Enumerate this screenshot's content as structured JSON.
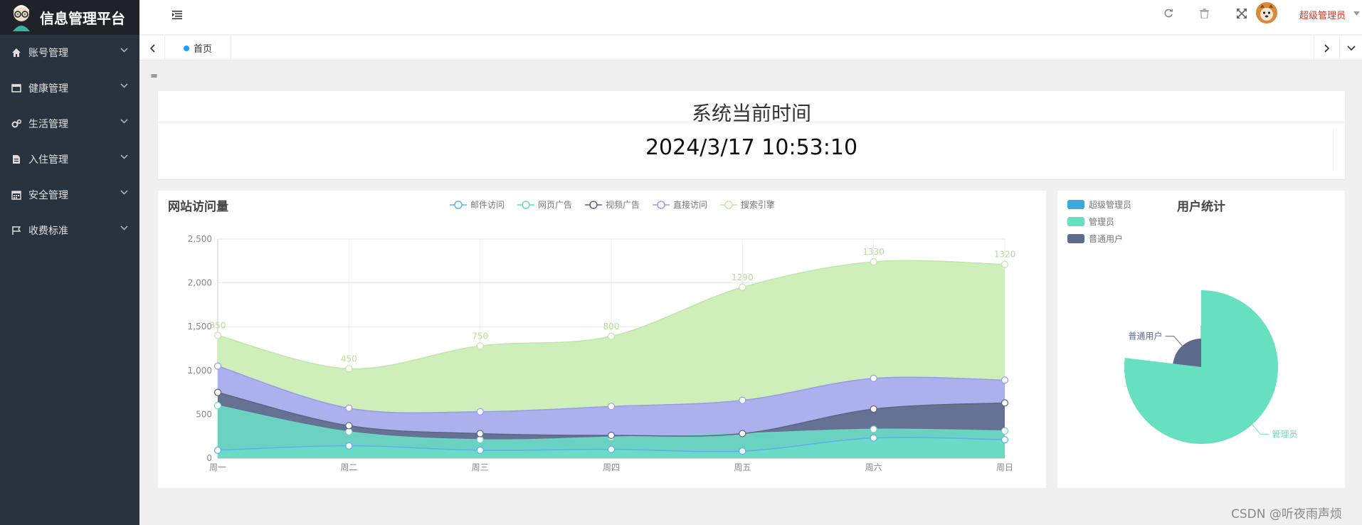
{
  "app": {
    "title": "信息管理平台"
  },
  "sidebar": {
    "items": [
      {
        "label": "账号管理",
        "icon": "home-icon"
      },
      {
        "label": "健康管理",
        "icon": "window-icon"
      },
      {
        "label": "生活管理",
        "icon": "gears-icon"
      },
      {
        "label": "入住管理",
        "icon": "file-icon"
      },
      {
        "label": "安全管理",
        "icon": "calendar-icon"
      },
      {
        "label": "收费标准",
        "icon": "flag-icon"
      }
    ]
  },
  "header": {
    "user_name": "超级管理员"
  },
  "tabs": {
    "home_label": "首页"
  },
  "content": {
    "marker": "="
  },
  "time_card": {
    "title": "系统当前时间",
    "datetime": "2024/3/17 10:53:10"
  },
  "colors": {
    "sidebar": "#28333e",
    "logo_bg": "#20222a",
    "accent": "#1e9fff",
    "user_name": "#d93a2b"
  },
  "watermark": "CSDN @听夜雨声烦",
  "chart_data": [
    {
      "type": "area",
      "title": "网站访问量",
      "categories": [
        "周一",
        "周二",
        "周三",
        "周四",
        "周五",
        "周六",
        "周日"
      ],
      "stacked": true,
      "smooth": true,
      "ylim": [
        0,
        2500
      ],
      "yticks": [
        0,
        500,
        1000,
        1500,
        2000,
        2500
      ],
      "ytick_labels": [
        "0",
        "500",
        "1,000",
        "1,500",
        "2,000",
        "2,500"
      ],
      "grid": true,
      "legend_position": "top-center",
      "series": [
        {
          "name": "邮件访问",
          "values": [
            90,
            140,
            90,
            100,
            80,
            230,
            210
          ],
          "color": "#6bdcc5",
          "stroke": "#5ab1ef"
        },
        {
          "name": "网页广告",
          "values": [
            510,
            160,
            120,
            140,
            200,
            100,
            100
          ],
          "color": "#6bdcc5",
          "stroke": "#6ad7c5"
        },
        {
          "name": "视频广告",
          "values": [
            150,
            70,
            70,
            20,
            0,
            230,
            320
          ],
          "color": "#5e6b8a",
          "stroke": "#5e6380"
        },
        {
          "name": "直接访问",
          "values": [
            300,
            200,
            250,
            330,
            380,
            350,
            260
          ],
          "color": "#a9a9f2",
          "stroke": "#9a9ae9"
        },
        {
          "name": "搜索引擎",
          "values": [
            350,
            450,
            750,
            800,
            1290,
            1330,
            1320
          ],
          "color": "#c9ecb2",
          "stroke": "#c0e6a8",
          "labels": [
            "350",
            "450",
            "750",
            "800",
            "1290",
            "1330",
            "1320"
          ]
        }
      ]
    },
    {
      "type": "pie",
      "title": "用户统计",
      "rose": true,
      "legend_position": "top-left",
      "slices": [
        {
          "name": "超级管理员",
          "value": 0,
          "color": "#3aa8dc"
        },
        {
          "name": "管理员",
          "value": 10,
          "color": "#67e0bf"
        },
        {
          "name": "普通用户",
          "value": 3,
          "color": "#5e6a8c"
        }
      ]
    }
  ]
}
